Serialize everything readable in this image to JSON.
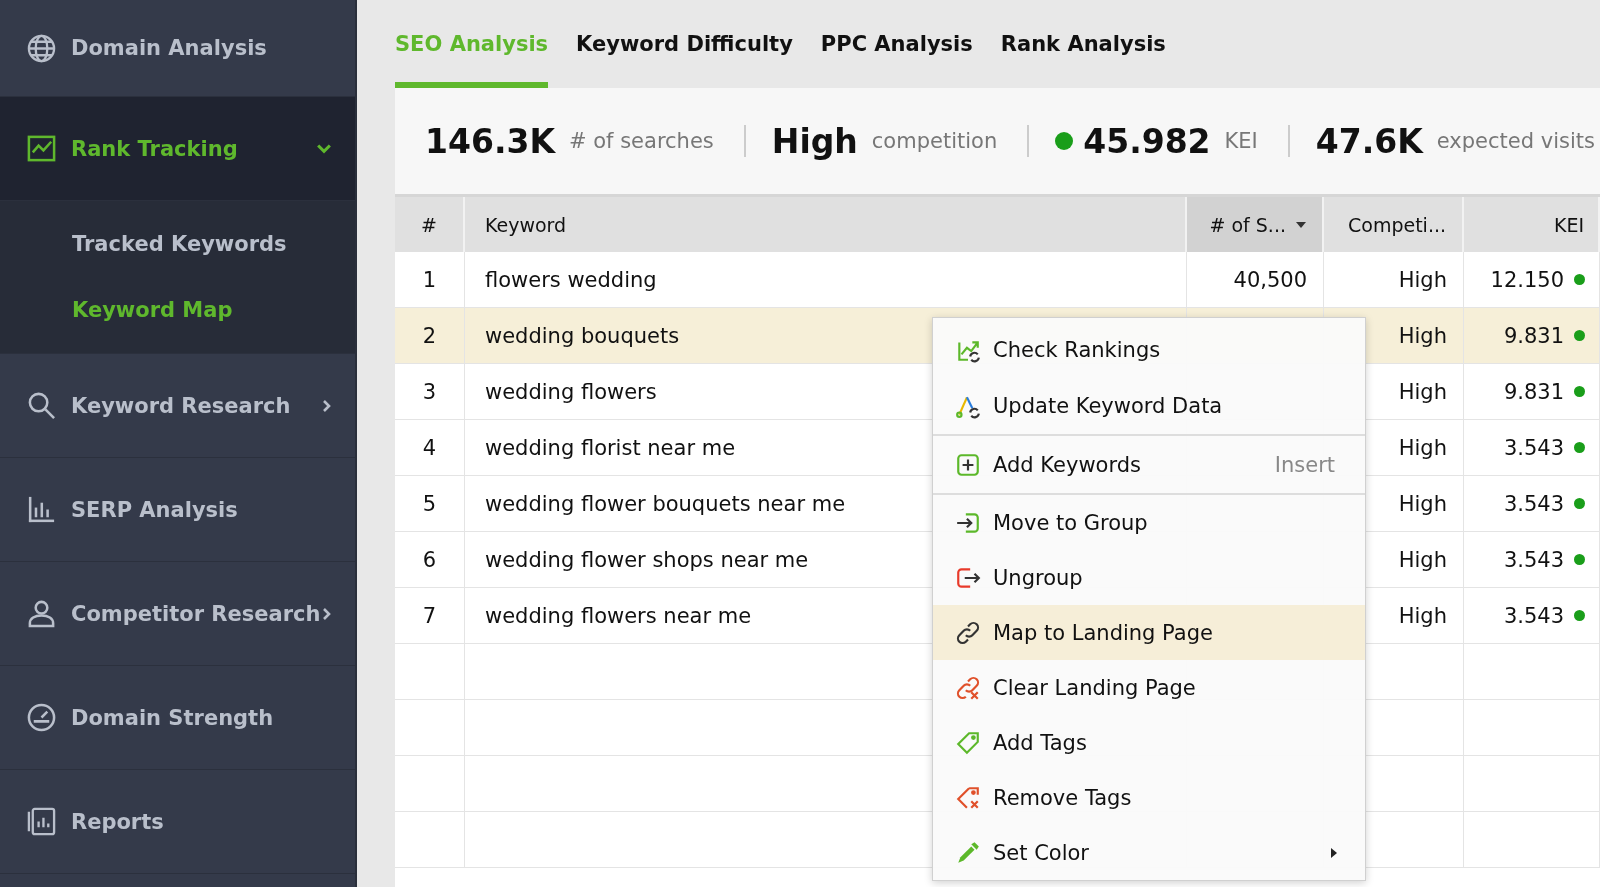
{
  "sidebar": {
    "items": [
      {
        "label": "Domain Analysis",
        "selected": false,
        "expanded": false,
        "submenu": false
      },
      {
        "label": "Rank Tracking",
        "selected": true,
        "expanded": true,
        "children": [
          {
            "label": "Tracked Keywords",
            "selected": false
          },
          {
            "label": "Keyword Map",
            "selected": true
          }
        ]
      },
      {
        "label": "Keyword Research",
        "selected": false,
        "expanded": false,
        "submenu": true
      },
      {
        "label": "SERP Analysis",
        "selected": false,
        "expanded": false,
        "submenu": false
      },
      {
        "label": "Competitor Research",
        "selected": false,
        "expanded": false,
        "submenu": true
      },
      {
        "label": "Domain Strength",
        "selected": false,
        "expanded": false,
        "submenu": false
      },
      {
        "label": "Reports",
        "selected": false,
        "expanded": false,
        "submenu": false
      }
    ]
  },
  "tabs": [
    {
      "label": "SEO Analysis",
      "selected": true
    },
    {
      "label": "Keyword Difficulty",
      "selected": false
    },
    {
      "label": "PPC Analysis",
      "selected": false
    },
    {
      "label": "Rank Analysis",
      "selected": false
    }
  ],
  "stats": [
    {
      "value": "146.3K",
      "label": "# of searches"
    },
    {
      "value": "High",
      "label": "competition"
    },
    {
      "value": "45.982",
      "label": "KEI",
      "color": "#1a9e1a"
    },
    {
      "value": "47.6K",
      "label": "expected visits"
    }
  ],
  "table": {
    "columns": [
      "#",
      "Keyword",
      "# of S...",
      "Competi...",
      "KEI"
    ],
    "rows": [
      {
        "num": "1",
        "keyword": "flowers wedding",
        "searches": "40,500",
        "competition": "High",
        "kei": "12.150",
        "selected": false
      },
      {
        "num": "2",
        "keyword": "wedding bouquets",
        "competition": "High",
        "kei": "9.831",
        "selected": true
      },
      {
        "num": "3",
        "keyword": "wedding flowers",
        "competition": "High",
        "kei": "9.831",
        "selected": false
      },
      {
        "num": "4",
        "keyword": "wedding florist near me",
        "competition": "High",
        "kei": "3.543",
        "selected": false
      },
      {
        "num": "5",
        "keyword": "wedding flower bouquets near me",
        "competition": "High",
        "kei": "3.543",
        "selected": false
      },
      {
        "num": "6",
        "keyword": "wedding flower shops near me",
        "competition": "High",
        "kei": "3.543",
        "selected": false
      },
      {
        "num": "7",
        "keyword": "wedding flowers near me",
        "competition": "High",
        "kei": "3.543",
        "selected": false
      }
    ]
  },
  "context_menu": {
    "items": [
      {
        "label": "Check Rankings",
        "selected": false,
        "separator_after": false
      },
      {
        "label": "Update Keyword Data",
        "selected": false,
        "separator_after": true
      },
      {
        "label": "Add Keywords",
        "shortcut": "Insert",
        "selected": false,
        "separator_after": true
      },
      {
        "label": "Move to Group",
        "selected": false,
        "separator_after": false
      },
      {
        "label": "Ungroup",
        "selected": false,
        "separator_after": false
      },
      {
        "label": "Map to Landing Page",
        "selected": true,
        "separator_after": false
      },
      {
        "label": "Clear Landing Page",
        "selected": false,
        "separator_after": false
      },
      {
        "label": "Add Tags",
        "selected": false,
        "separator_after": false
      },
      {
        "label": "Remove Tags",
        "selected": false,
        "separator_after": false
      },
      {
        "label": "Set Color",
        "selected": false,
        "separator_after": false,
        "submenu": true
      }
    ]
  }
}
